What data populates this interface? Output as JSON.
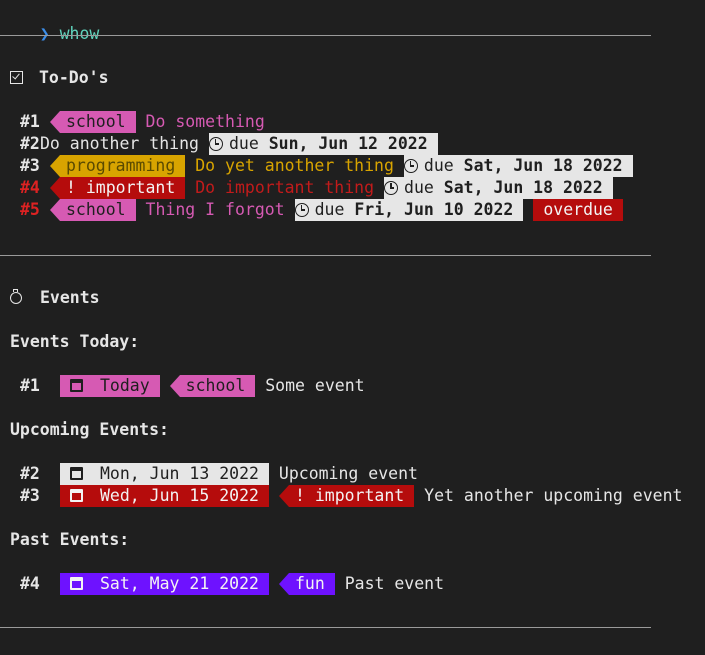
{
  "prompt": {
    "arrow": "❯",
    "command": "whow"
  },
  "todos": {
    "title": "To-Do's",
    "items": [
      {
        "num": "#1",
        "tag": "school",
        "text": "Do something"
      },
      {
        "num": "#2",
        "text": "Do another thing",
        "due_prefix": "due",
        "due_date": "Sun, Jun 12 2022"
      },
      {
        "num": "#3",
        "tag": "programming",
        "text": "Do yet another thing",
        "due_prefix": "due",
        "due_date": "Sat, Jun 18 2022"
      },
      {
        "num": "#4",
        "tag": "! important",
        "text": "Do important thing",
        "due_prefix": "due",
        "due_date": "Sat, Jun 18 2022"
      },
      {
        "num": "#5",
        "tag": "school",
        "text": "Thing I forgot",
        "due_prefix": "due",
        "due_date": "Fri, Jun 10 2022",
        "status": "overdue"
      }
    ]
  },
  "events": {
    "title": "Events",
    "today_heading": "Events Today:",
    "upcoming_heading": "Upcoming Events:",
    "past_heading": "Past Events:",
    "today": [
      {
        "num": "#1",
        "date": "Today",
        "tag": "school",
        "text": "Some event"
      }
    ],
    "upcoming": [
      {
        "num": "#2",
        "date": "Mon, Jun 13 2022",
        "text": "Upcoming event"
      },
      {
        "num": "#3",
        "date": "Wed, Jun 15 2022",
        "tag": "! important",
        "text": "Yet another upcoming event"
      }
    ],
    "past": [
      {
        "num": "#4",
        "date": "Sat, May 21 2022",
        "tag": "fun",
        "text": "Past event"
      }
    ]
  },
  "colors": {
    "background": "#1f1f1f",
    "pink": "#d65ab3",
    "yellow": "#d8a400",
    "red": "#b50c0c",
    "purple": "#6e12ff"
  }
}
